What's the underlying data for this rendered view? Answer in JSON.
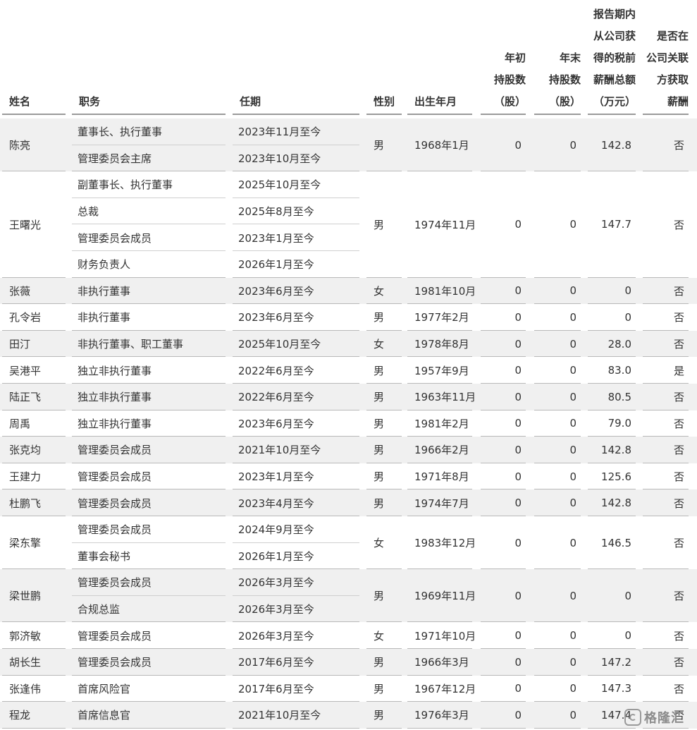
{
  "headers": {
    "name": [
      "姓名"
    ],
    "position": [
      "职务"
    ],
    "term": [
      "任期"
    ],
    "gender": [
      "性别"
    ],
    "birth": [
      "出生年月"
    ],
    "start_shares": [
      "年初",
      "持股数",
      "（股）"
    ],
    "end_shares": [
      "年末",
      "持股数",
      "（股）"
    ],
    "salary": [
      "报告期内",
      "从公司获",
      "得的税前",
      "薪酬总额",
      "（万元）"
    ],
    "related": [
      "是否在",
      "公司关联",
      "方获取",
      "薪酬"
    ]
  },
  "people": [
    {
      "name": "陈亮",
      "roles": [
        {
          "title": "董事长、执行董事",
          "term": "2023年11月至今"
        },
        {
          "title": "管理委员会主席",
          "term": "2023年10月至今"
        }
      ],
      "gender": "男",
      "birth": "1968年1月",
      "start_shares": "0",
      "end_shares": "0",
      "salary": "142.8",
      "related": "否"
    },
    {
      "name": "王曙光",
      "roles": [
        {
          "title": "副董事长、执行董事",
          "term": "2025年10月至今"
        },
        {
          "title": "总裁",
          "term": "2025年8月至今"
        },
        {
          "title": "管理委员会成员",
          "term": "2023年1月至今"
        },
        {
          "title": "财务负责人",
          "term": "2026年1月至今"
        }
      ],
      "gender": "男",
      "birth": "1974年11月",
      "start_shares": "0",
      "end_shares": "0",
      "salary": "147.7",
      "related": "否"
    },
    {
      "name": "张薇",
      "roles": [
        {
          "title": "非执行董事",
          "term": "2023年6月至今"
        }
      ],
      "gender": "女",
      "birth": "1981年10月",
      "start_shares": "0",
      "end_shares": "0",
      "salary": "0",
      "related": "否"
    },
    {
      "name": "孔令岩",
      "roles": [
        {
          "title": "非执行董事",
          "term": "2023年6月至今"
        }
      ],
      "gender": "男",
      "birth": "1977年2月",
      "start_shares": "0",
      "end_shares": "0",
      "salary": "0",
      "related": "否"
    },
    {
      "name": "田汀",
      "roles": [
        {
          "title": "非执行董事、职工董事",
          "term": "2025年10月至今"
        }
      ],
      "gender": "女",
      "birth": "1978年8月",
      "start_shares": "0",
      "end_shares": "0",
      "salary": "28.0",
      "related": "否"
    },
    {
      "name": "吴港平",
      "roles": [
        {
          "title": "独立非执行董事",
          "term": "2022年6月至今"
        }
      ],
      "gender": "男",
      "birth": "1957年9月",
      "start_shares": "0",
      "end_shares": "0",
      "salary": "83.0",
      "related": "是"
    },
    {
      "name": "陆正飞",
      "roles": [
        {
          "title": "独立非执行董事",
          "term": "2022年6月至今"
        }
      ],
      "gender": "男",
      "birth": "1963年11月",
      "start_shares": "0",
      "end_shares": "0",
      "salary": "80.5",
      "related": "否"
    },
    {
      "name": "周禹",
      "roles": [
        {
          "title": "独立非执行董事",
          "term": "2023年6月至今"
        }
      ],
      "gender": "男",
      "birth": "1981年2月",
      "start_shares": "0",
      "end_shares": "0",
      "salary": "79.0",
      "related": "否"
    },
    {
      "name": "张克均",
      "roles": [
        {
          "title": "管理委员会成员",
          "term": "2021年10月至今"
        }
      ],
      "gender": "男",
      "birth": "1966年2月",
      "start_shares": "0",
      "end_shares": "0",
      "salary": "142.8",
      "related": "否"
    },
    {
      "name": "王建力",
      "roles": [
        {
          "title": "管理委员会成员",
          "term": "2023年1月至今"
        }
      ],
      "gender": "男",
      "birth": "1971年8月",
      "start_shares": "0",
      "end_shares": "0",
      "salary": "125.6",
      "related": "否"
    },
    {
      "name": "杜鹏飞",
      "roles": [
        {
          "title": "管理委员会成员",
          "term": "2023年4月至今"
        }
      ],
      "gender": "男",
      "birth": "1974年7月",
      "start_shares": "0",
      "end_shares": "0",
      "salary": "142.8",
      "related": "否"
    },
    {
      "name": "梁东擎",
      "roles": [
        {
          "title": "管理委员会成员",
          "term": "2024年9月至今"
        },
        {
          "title": "董事会秘书",
          "term": "2026年1月至今"
        }
      ],
      "gender": "女",
      "birth": "1983年12月",
      "start_shares": "0",
      "end_shares": "0",
      "salary": "146.5",
      "related": "否"
    },
    {
      "name": "梁世鹏",
      "roles": [
        {
          "title": "管理委员会成员",
          "term": "2026年3月至今"
        },
        {
          "title": "合规总监",
          "term": "2026年3月至今"
        }
      ],
      "gender": "男",
      "birth": "1969年11月",
      "start_shares": "0",
      "end_shares": "0",
      "salary": "0",
      "related": "否"
    },
    {
      "name": "郭济敏",
      "roles": [
        {
          "title": "管理委员会成员",
          "term": "2026年3月至今"
        }
      ],
      "gender": "女",
      "birth": "1971年10月",
      "start_shares": "0",
      "end_shares": "0",
      "salary": "0",
      "related": "否"
    },
    {
      "name": "胡长生",
      "roles": [
        {
          "title": "管理委员会成员",
          "term": "2017年6月至今"
        }
      ],
      "gender": "男",
      "birth": "1966年3月",
      "start_shares": "0",
      "end_shares": "0",
      "salary": "147.2",
      "related": "否"
    },
    {
      "name": "张逢伟",
      "roles": [
        {
          "title": "首席风险官",
          "term": "2017年6月至今"
        }
      ],
      "gender": "男",
      "birth": "1967年12月",
      "start_shares": "0",
      "end_shares": "0",
      "salary": "147.3",
      "related": "否"
    },
    {
      "name": "程龙",
      "roles": [
        {
          "title": "首席信息官",
          "term": "2021年10月至今"
        }
      ],
      "gender": "男",
      "birth": "1976年3月",
      "start_shares": "0",
      "end_shares": "0",
      "salary": "147.4",
      "related": "否"
    }
  ],
  "watermark": {
    "text": "格隆汇",
    "icon": "gelonghui-logo-icon"
  }
}
